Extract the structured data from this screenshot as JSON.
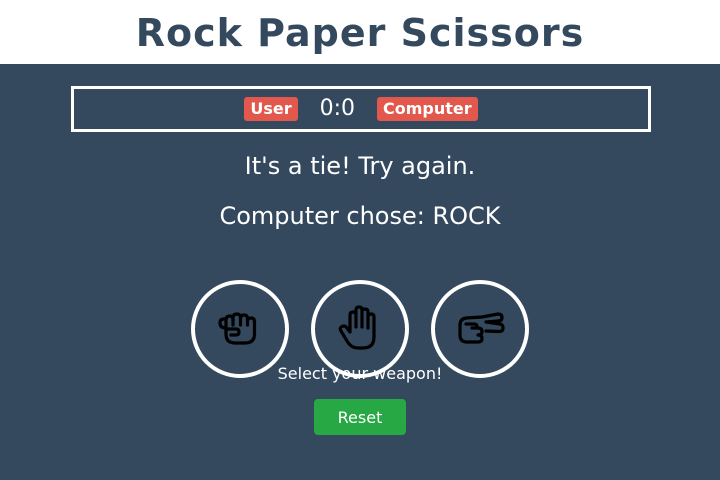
{
  "header": {
    "title": "Rock Paper Scissors"
  },
  "scoreboard": {
    "user_label": "User",
    "score": "0:0",
    "computer_label": "Computer"
  },
  "result": {
    "message": "It's a tie! Try again.",
    "computer_choice": "Computer chose: ROCK"
  },
  "choices": [
    {
      "name": "rock",
      "icon": "hand-rock-icon"
    },
    {
      "name": "paper",
      "icon": "hand-paper-icon"
    },
    {
      "name": "scissors",
      "icon": "hand-scissors-icon"
    }
  ],
  "prompt": "Select your weapon!",
  "reset_label": "Reset",
  "colors": {
    "background": "#34495e",
    "badge": "#e2584d",
    "reset": "#28a745",
    "title": "#34495e"
  }
}
